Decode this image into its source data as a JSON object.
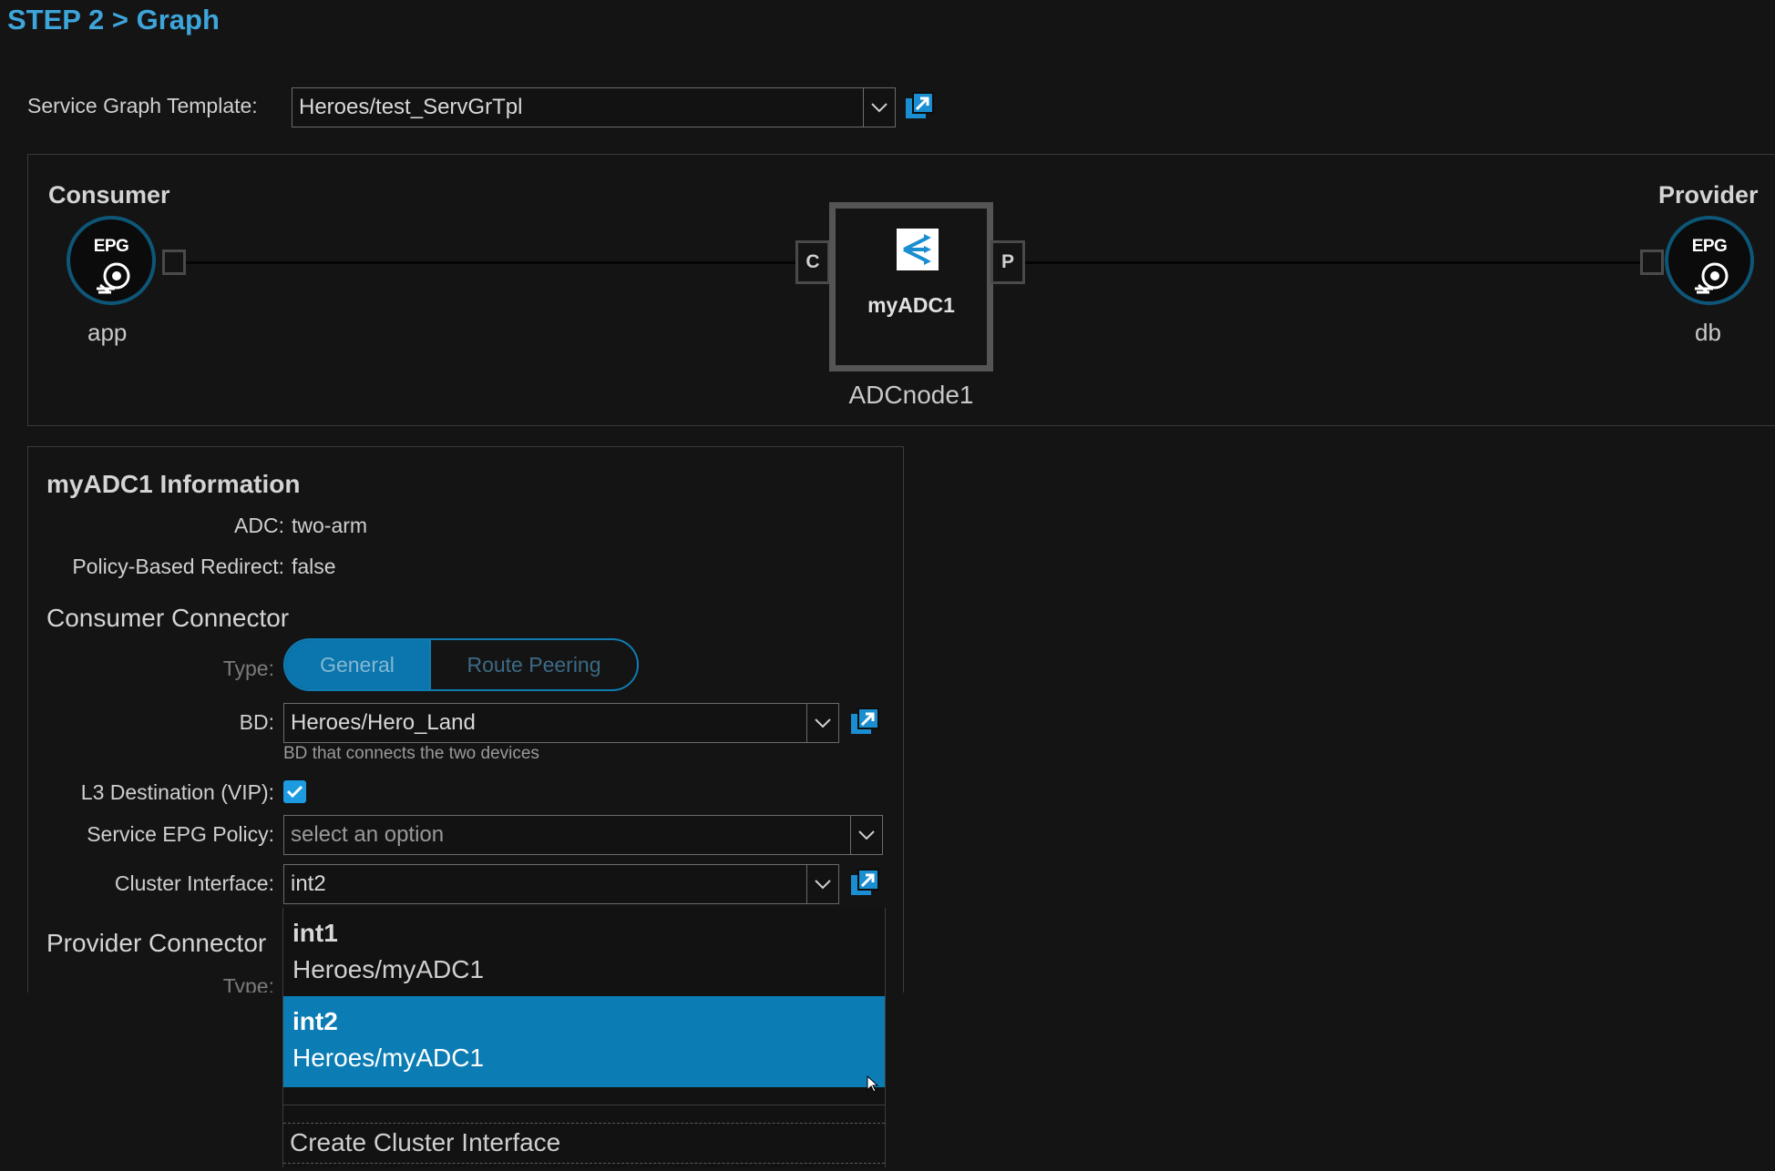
{
  "header": {
    "title": "STEP 2 > Graph"
  },
  "service_graph": {
    "label": "Service Graph Template:",
    "value": "Heroes/test_ServGrTpl"
  },
  "graph": {
    "consumer": {
      "heading": "Consumer",
      "badge": "EPG",
      "name": "app"
    },
    "provider": {
      "heading": "Provider",
      "badge": "EPG",
      "name": "db"
    },
    "node": {
      "title": "myADC1",
      "name": "ADCnode1",
      "consumer_port": "C",
      "provider_port": "P"
    }
  },
  "info": {
    "title": "myADC1 Information",
    "adc_label": "ADC:",
    "adc_value": "two-arm",
    "pbr_label": "Policy-Based Redirect:",
    "pbr_value": "false",
    "consumer_heading": "Consumer Connector",
    "type_label": "Type:",
    "type_options": [
      "General",
      "Route Peering"
    ],
    "type_selected": "General",
    "bd_label": "BD:",
    "bd_value": "Heroes/Hero_Land",
    "bd_hint": "BD that connects the two devices",
    "l3_label": "L3 Destination (VIP):",
    "l3_checked": true,
    "epg_policy_label": "Service EPG Policy:",
    "epg_policy_placeholder": "select an option",
    "cluster_label": "Cluster Interface:",
    "cluster_value": "int2",
    "provider_heading": "Provider Connector",
    "provider_type_label": "Type:"
  },
  "dropdown": {
    "items": [
      {
        "name": "int1",
        "tenant": "Heroes/myADC1",
        "selected": false
      },
      {
        "name": "int2",
        "tenant": "Heroes/myADC1",
        "selected": true
      }
    ],
    "create_label": "Create Cluster Interface"
  },
  "colors": {
    "accent": "#0b7db4",
    "title": "#3ea5db",
    "background": "#141414"
  },
  "icons": [
    "chevron-down-icon",
    "external-link-icon",
    "epg-icon",
    "adc-node-icon",
    "checkmark-icon",
    "mouse-cursor-icon"
  ]
}
